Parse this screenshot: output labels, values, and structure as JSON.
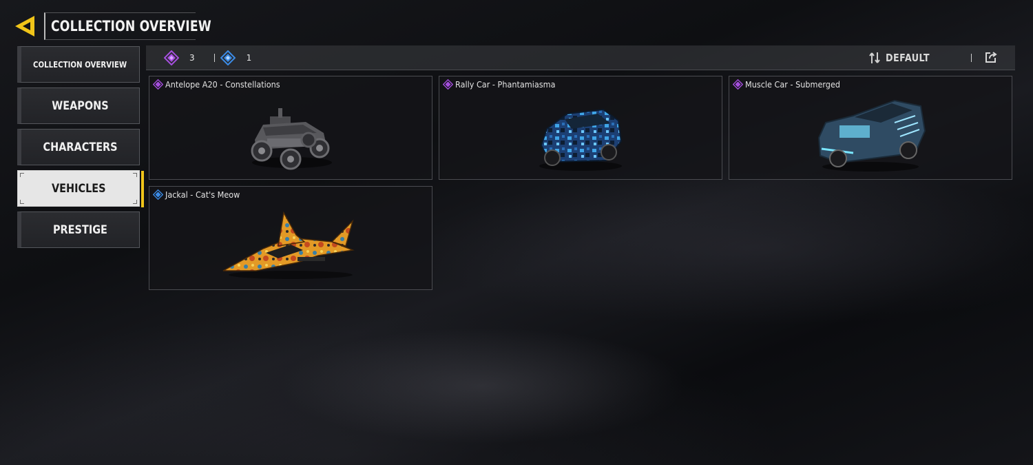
{
  "header": {
    "title": "COLLECTION OVERVIEW",
    "back_icon": "back-arrow-icon",
    "accent_color": "#f0c419"
  },
  "sidebar": {
    "items": [
      {
        "label": "COLLECTION OVERVIEW",
        "active": false
      },
      {
        "label": "WEAPONS",
        "active": false
      },
      {
        "label": "CHARACTERS",
        "active": false
      },
      {
        "label": "VEHICLES",
        "active": true
      },
      {
        "label": "PRESTIGE",
        "active": false
      }
    ]
  },
  "filter": {
    "epic_count": "3",
    "rare_count": "1",
    "epic_color": "#a64fe0",
    "rare_color": "#3b8be6",
    "sort_label": "DEFAULT",
    "sort_icon": "sort-arrows-icon",
    "share_icon": "share-icon"
  },
  "items": [
    {
      "name": "Antelope A20 - Constellations",
      "rarity": "epic",
      "art": "offroad-buggy"
    },
    {
      "name": "Rally Car - Phantamiasma",
      "rarity": "epic",
      "art": "rally-car"
    },
    {
      "name": "Muscle Car - Submerged",
      "rarity": "epic",
      "art": "muscle-car"
    },
    {
      "name": "Jackal - Cat's Meow",
      "rarity": "rare",
      "art": "jet"
    }
  ]
}
